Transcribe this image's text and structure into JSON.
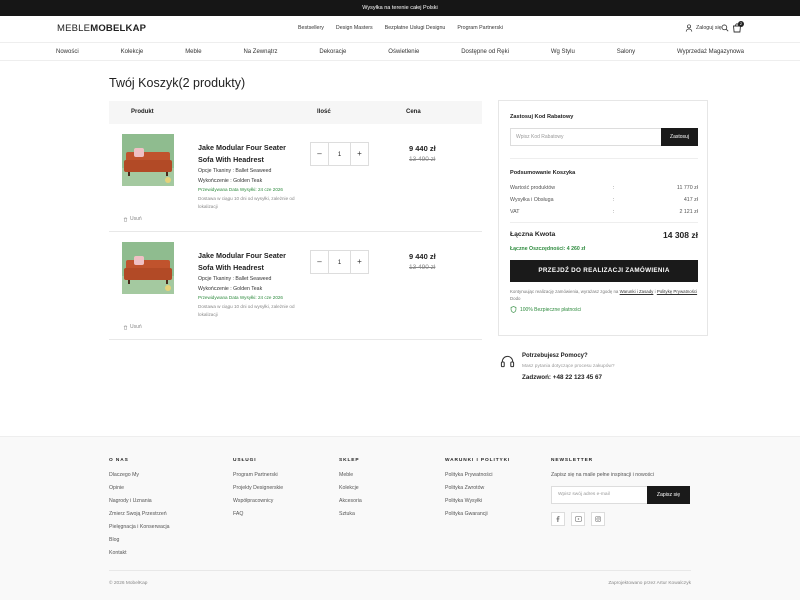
{
  "topbar": {
    "text": "Wysyłka na terenie całej Polski"
  },
  "header": {
    "logo_thin": "MEBLE",
    "logo_bold": "MOBELKAP",
    "nav": [
      "Bestsellery",
      "Design Masters",
      "Bezpłatne Usługi Designu",
      "Program Partnerski"
    ],
    "login_label": "Zaloguj się",
    "cart_count": "2"
  },
  "categories": [
    "Nowości",
    "Kolekcje",
    "Meble",
    "Na Zewnątrz",
    "Dekoracje",
    "Oświetlenie",
    "Dostępne od Ręki",
    "Wg Stylu",
    "Salony",
    "Wyprzedaż Magazynowa"
  ],
  "cart": {
    "title": "Twój Koszyk(2 produkty)",
    "headers": {
      "product": "Produkt",
      "quantity": "Ilość",
      "price": "Cena"
    },
    "items": [
      {
        "name": "Jake Modular Four Seater Sofa With Headrest",
        "fabric": "Opcje Tkaniny : Ballet Seaweed",
        "finish": "Wykończenie : Golden Teak",
        "shipping_date": "Przewidywana Data Wysyłki: 24 cze 2026",
        "delivery_note": "Dostawa w ciągu 10 dni od wysyłki, zależnie od lokalizacji",
        "delete_label": "Usuń",
        "qty": "1",
        "price": "9 440 zł",
        "old_price": "13 490 zł"
      },
      {
        "name": "Jake Modular Four Seater Sofa With Headrest",
        "fabric": "Opcje Tkaniny : Ballet Seaweed",
        "finish": "Wykończenie : Golden Teak",
        "shipping_date": "Przewidywana Data Wysyłki: 24 cze 2026",
        "delivery_note": "Dostawa w ciągu 10 dni od wysyłki, zależnie od lokalizacji",
        "delete_label": "Usuń",
        "qty": "1",
        "price": "9 440 zł",
        "old_price": "13 490 zł"
      }
    ],
    "minus": "–",
    "plus": "+"
  },
  "summary": {
    "coupon_title": "Zastosuj Kod Rabatowy",
    "coupon_placeholder": "Wpisz Kod Rabatowy",
    "coupon_button": "Zastosuj",
    "summary_title": "Podsumowanie Koszyka",
    "rows": [
      {
        "label": "Wartość produktów",
        "sep": ":",
        "value": "11 770 zł"
      },
      {
        "label": "Wysyłka i Obsługa",
        "sep": ":",
        "value": "417 zł"
      },
      {
        "label": "VAT",
        "sep": ":",
        "value": "2 121 zł"
      }
    ],
    "total_label": "Łączna Kwota",
    "total_value": "14 308 zł",
    "savings": "Łączne Oszczędności: 4 260 zł",
    "checkout_button": "PRZEJDŹ DO REALIZACJI ZAMÓWIENIA",
    "terms_prefix": "Kontynuując realizację zamówienia, wyrażasz zgodę na",
    "terms_link": "Warunki i Zasady",
    "terms_and": "i",
    "privacy_link": "Politykę Prywatności",
    "terms_suffix": "Dodo",
    "secure": "100% Bezpieczne płatności"
  },
  "help": {
    "title": "Potrzebujesz Pomocy?",
    "subtitle": "Masz pytania dotyczące procesu zakupów?",
    "phone": "Zadzwoń: +48 22 123 45 67"
  },
  "footer": {
    "about": {
      "title": "O NAS",
      "links": [
        "Dlaczego My",
        "Opinie",
        "Nagrody i Uznania",
        "Zmierz Swoją Przestrzeń",
        "Pielęgnacja i Konserwacja",
        "Blog",
        "Kontakt"
      ]
    },
    "services": {
      "title": "USŁUGI",
      "links": [
        "Program Partnerski",
        "Projekty Designerskie",
        "Współpracownicy",
        "FAQ"
      ]
    },
    "shop": {
      "title": "SKLEP",
      "links": [
        "Meble",
        "Kolekcje",
        "Akcesoria",
        "Sztuka"
      ]
    },
    "policies": {
      "title": "WARUNKI I POLITYKI",
      "links": [
        "Polityka Prywatności",
        "Polityka Zwrotów",
        "Polityka Wysyłki",
        "Polityka Gwarancji"
      ]
    },
    "newsletter": {
      "title": "NEWSLETTER",
      "text": "Zapisz się na maile pełne inspiracji i nowości",
      "placeholder": "Wpisz swój adres e-mail",
      "button": "Zapisz się"
    },
    "social_icons": [
      "facebook-icon",
      "youtube-icon",
      "instagram-icon"
    ],
    "copyright": "© 2026 MobelKap",
    "credit": "Zaprojektowano przez Artur Kowalczyk"
  },
  "colors": {
    "dark": "#1a1a1a",
    "green": "#2e8b3e",
    "sofa": "#c0532d"
  }
}
